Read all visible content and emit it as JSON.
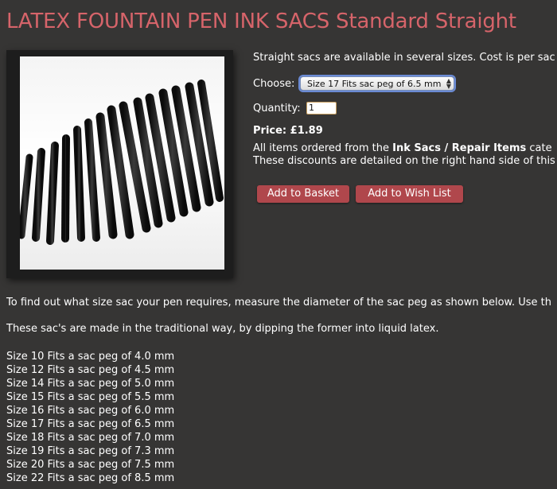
{
  "title": "LATEX FOUNTAIN PEN INK SACS Standard Straight",
  "description": "Straight sacs are available in several sizes. Cost is per sac",
  "choose": {
    "label": "Choose:",
    "selected": "Size 17 Fits sac peg of 6.5 mm"
  },
  "quantity": {
    "label": "Quantity:",
    "value": "1"
  },
  "price": {
    "label": "Price:",
    "value": "£1.89"
  },
  "note": {
    "line1_prefix": "All items ordered from the ",
    "line1_bold": "Ink Sacs / Repair Items",
    "line1_suffix": " cate",
    "line2": "These discounts are detailed on the right hand side of this"
  },
  "buttons": {
    "add_to_basket": "Add to Basket",
    "add_to_wish_list": "Add to Wish List"
  },
  "body": {
    "para1": "To find out what size sac your pen requires, measure the diameter of the sac peg as shown below. Use th",
    "para2": "These sac's are made in the traditional way, by dipping the former into liquid latex.",
    "sizes": [
      "Size 10 Fits a sac peg of 4.0 mm",
      "Size 12 Fits a sac peg of 4.5 mm",
      "Size 14 Fits a sac peg of 5.0 mm",
      "Size 15 Fits a sac peg of 5.5 mm",
      "Size 16 Fits a sac peg of 6.0 mm",
      "Size 17 Fits a sac peg of 6.5 mm",
      "Size 18 Fits a sac peg of 7.0 mm",
      "Size 19 Fits a sac peg of 7.3 mm",
      "Size 20 Fits a sac peg of 7.5 mm",
      "Size 22 Fits a sac peg of 8.5 mm"
    ]
  },
  "colors": {
    "background": "#363534",
    "title": "#d6646a",
    "button": "#b0474c"
  }
}
